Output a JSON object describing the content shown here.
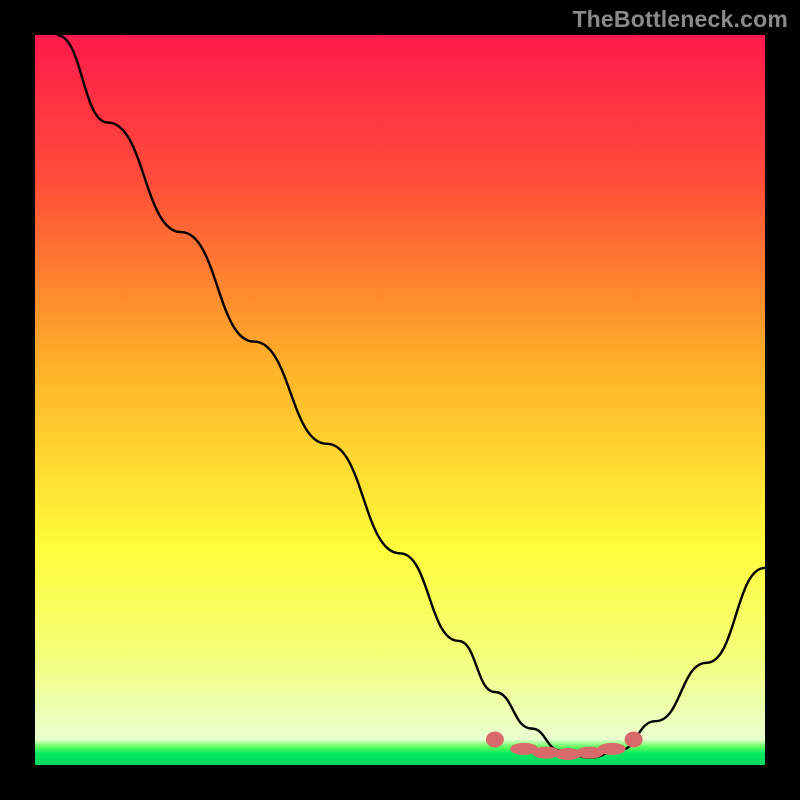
{
  "watermark": "TheBottleneck.com",
  "chart_data": {
    "type": "line",
    "title": "",
    "xlabel": "",
    "ylabel": "",
    "xlim": [
      0,
      100
    ],
    "ylim": [
      0,
      100
    ],
    "gradient_stops": [
      {
        "offset": 0,
        "color": "#ff1a4b"
      },
      {
        "offset": 0.2,
        "color": "#ff4d3a"
      },
      {
        "offset": 0.45,
        "color": "#ffb029"
      },
      {
        "offset": 0.7,
        "color": "#fffc3a"
      },
      {
        "offset": 0.85,
        "color": "#f4ff7a"
      },
      {
        "offset": 0.965,
        "color": "#eaffd0"
      },
      {
        "offset": 0.975,
        "color": "#61ff61"
      },
      {
        "offset": 0.985,
        "color": "#00e85e"
      },
      {
        "offset": 1.0,
        "color": "#00d860"
      }
    ],
    "series": [
      {
        "name": "bottleneck-curve",
        "color": "#000000",
        "x": [
          3,
          10,
          20,
          30,
          40,
          50,
          58,
          63,
          68,
          72,
          76,
          80,
          85,
          92,
          100
        ],
        "values": [
          100,
          88,
          73,
          58,
          44,
          29,
          17,
          10,
          5,
          2,
          1,
          2,
          6,
          14,
          27
        ]
      }
    ],
    "markers": {
      "name": "optimal-range",
      "color": "#d96a6a",
      "shape": "rounded",
      "points": [
        {
          "x": 63,
          "y": 3.5
        },
        {
          "x": 67,
          "y": 2.2
        },
        {
          "x": 70,
          "y": 1.7
        },
        {
          "x": 73,
          "y": 1.5
        },
        {
          "x": 76,
          "y": 1.7
        },
        {
          "x": 79,
          "y": 2.2
        },
        {
          "x": 82,
          "y": 3.5
        }
      ]
    }
  }
}
